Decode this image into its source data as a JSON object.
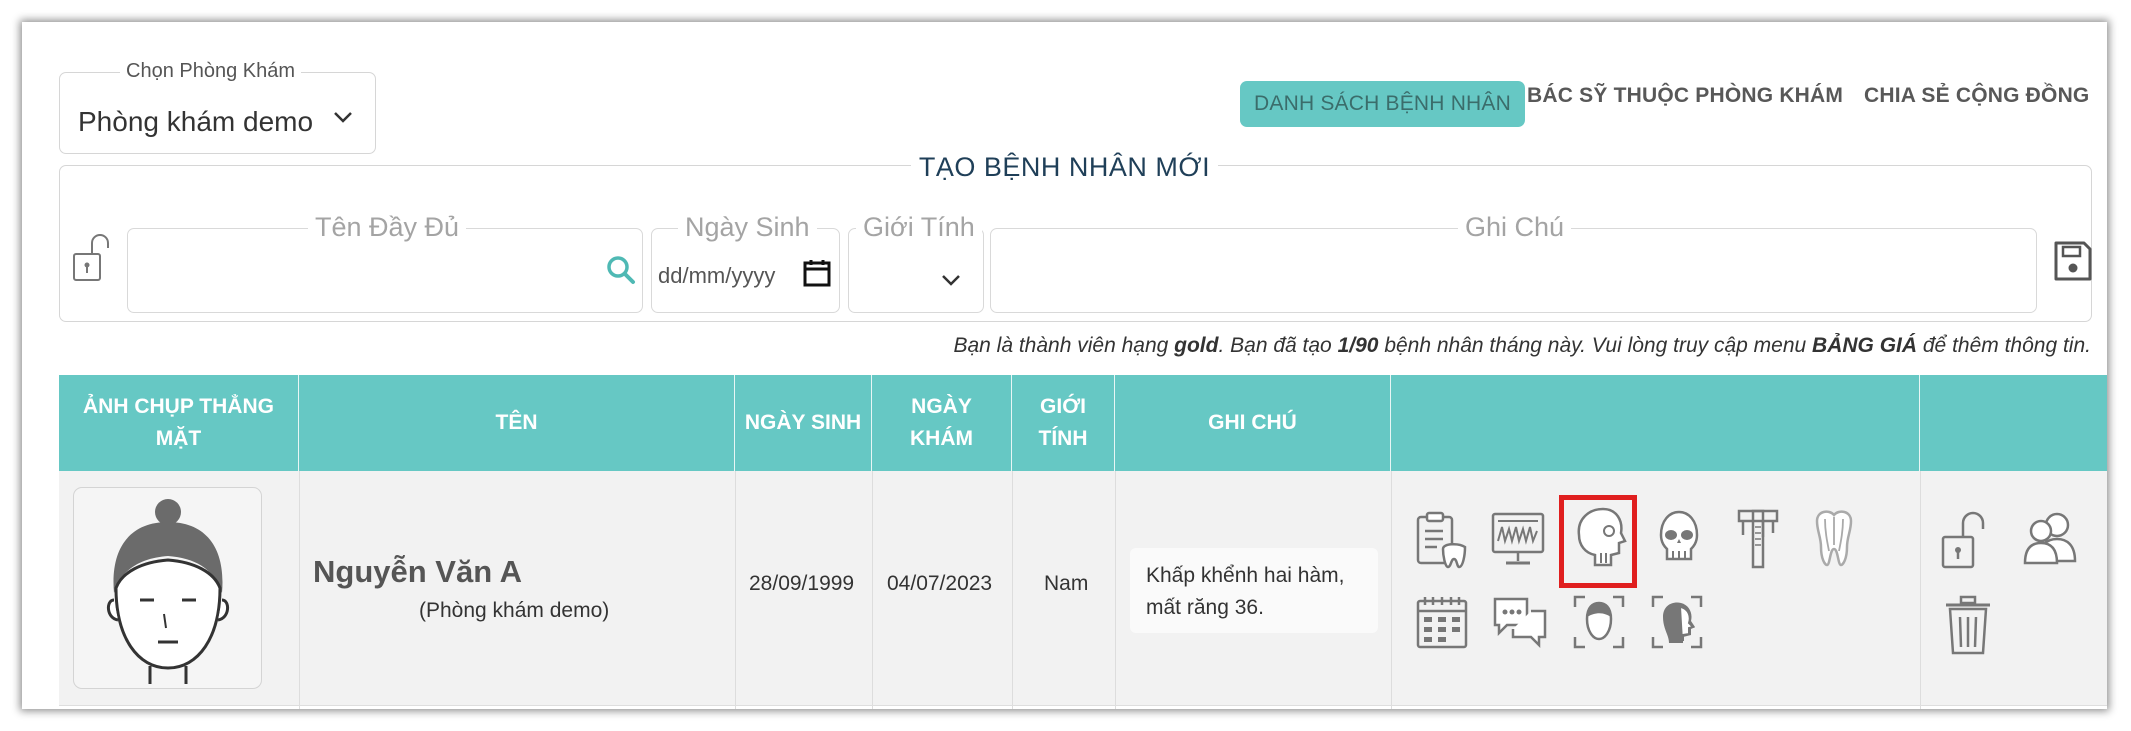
{
  "clinic_selector": {
    "legend": "Chọn Phòng Khám",
    "value": "Phòng khám demo"
  },
  "nav": {
    "patients": "DANH SÁCH BỆNH NHÂN",
    "doctors": "BÁC SỸ THUỘC PHÒNG KHÁM",
    "community": "CHIA SẺ CỘNG ĐỒNG"
  },
  "new_patient": {
    "title": "TẠO BỆNH NHÂN MỚI",
    "fullname_label": "Tên Đầy Đủ",
    "dob_label": "Ngày Sinh",
    "dob_placeholder": "dd/mm/yyyy",
    "gender_label": "Giới Tính",
    "notes_label": "Ghi Chú"
  },
  "membership_info": {
    "part1": "Bạn là thành viên hạng",
    "tier": "gold",
    "part2": ". Bạn đã tạo",
    "count": "1/90",
    "part3": "bệnh nhân tháng này. Vui lòng truy cập menu",
    "menu": "BẢNG GIÁ",
    "part4": "để thêm thông tin."
  },
  "table": {
    "headers": {
      "photo_line1": "ẢNH CHỤP THẲNG",
      "photo_line2": "MẶT",
      "name": "TÊN",
      "dob": "NGÀY SINH",
      "visit_line1": "NGÀY",
      "visit_line2": "KHÁM",
      "gender_line1": "GIỚI",
      "gender_line2": "TÍNH",
      "notes": "GHI CHÚ"
    },
    "rows": [
      {
        "name": "Nguyễn Văn A",
        "clinic": "(Phòng khám demo)",
        "dob": "28/09/1999",
        "visit_date": "04/07/2023",
        "gender": "Nam",
        "note_line1": "Khấp khểnh hai hàm,",
        "note_line2": "mất răng 36."
      }
    ]
  },
  "icons": [
    "clipboard-tooth-icon",
    "xray-monitor-icon",
    "skull-profile-icon",
    "skull-front-icon",
    "caliper-icon",
    "tooth-icon",
    "calendar-icon",
    "chat-icon",
    "face-front-scan-icon",
    "face-profile-scan-icon",
    "unlock-icon",
    "users-icon",
    "trash-icon",
    "search-icon",
    "save-icon",
    "calendar-picker-icon",
    "chevron-down-icon"
  ],
  "colors": {
    "accent": "#66c8c4",
    "highlight": "#e01f1f",
    "title": "#1f3f58"
  }
}
